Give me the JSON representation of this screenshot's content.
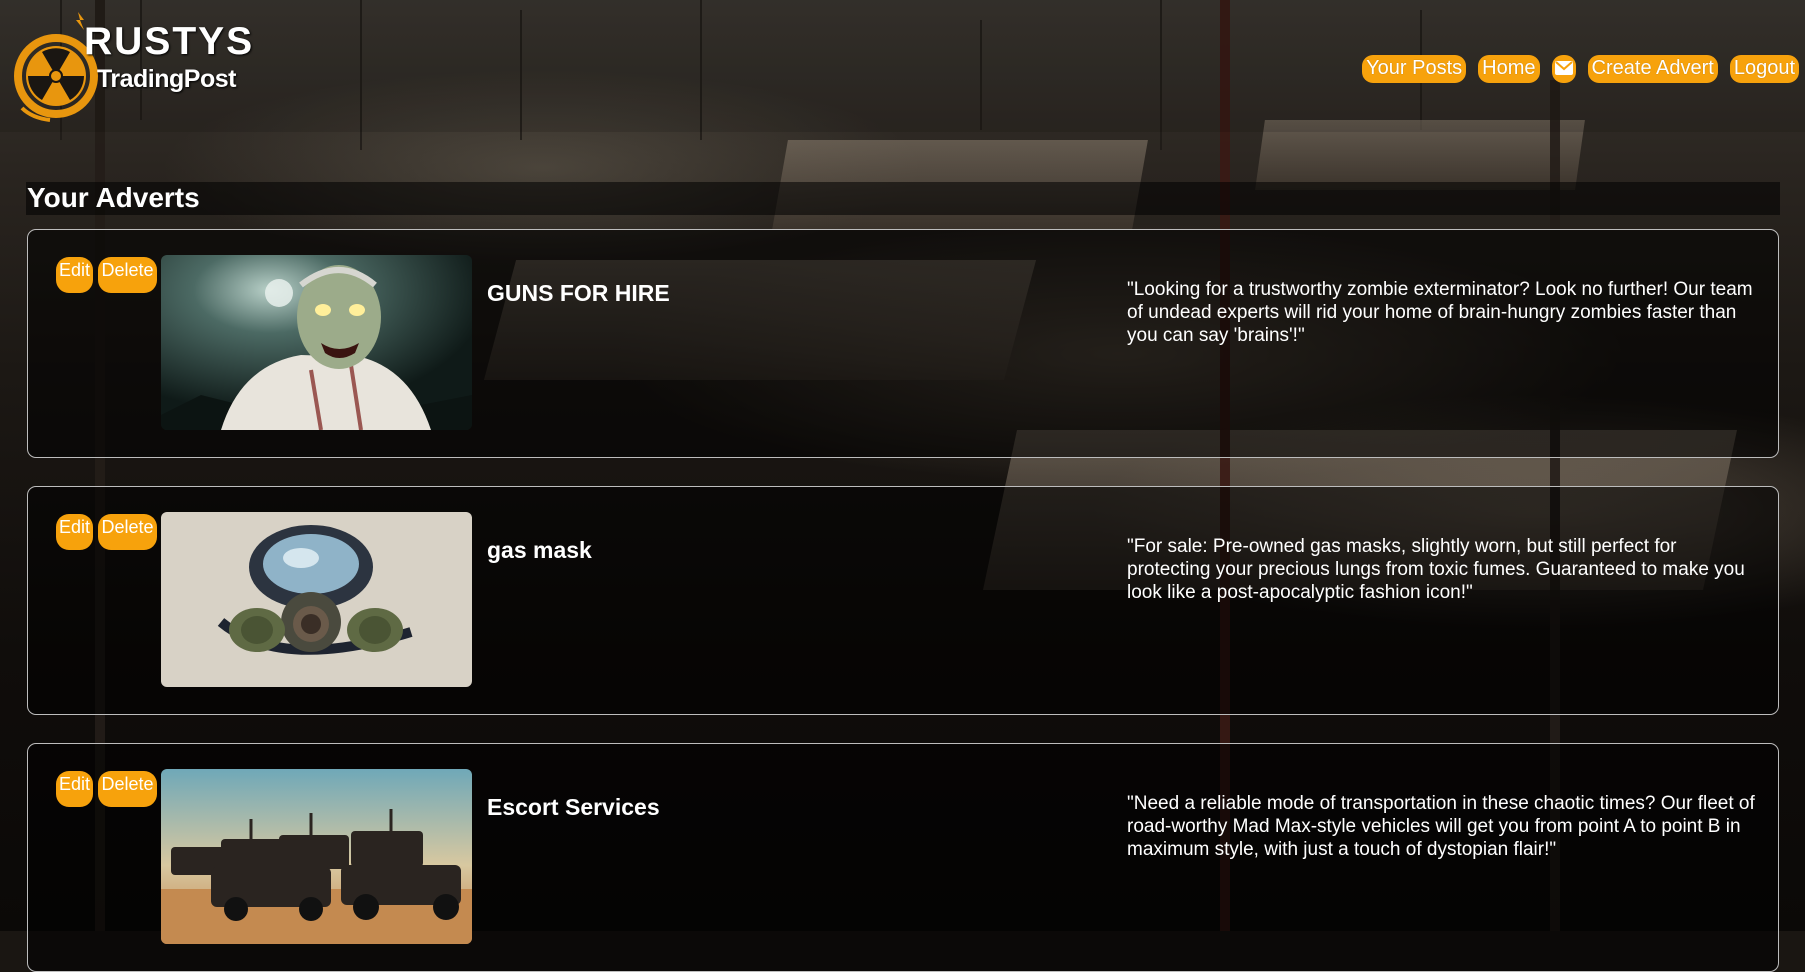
{
  "brand": {
    "name_top": "RUSTYS",
    "name_bottom": "TradingPost",
    "accent_color": "#f7a20c"
  },
  "nav": {
    "your_posts": "Your Posts",
    "home": "Home",
    "messages_icon": "envelope-icon",
    "create_advert": "Create Advert",
    "logout": "Logout"
  },
  "section": {
    "title": "Your Adverts"
  },
  "adverts": [
    {
      "edit_label": "Edit",
      "delete_label": "Delete",
      "image": "zombie-image",
      "title": "GUNS FOR HIRE",
      "description": "\"Looking for a trustworthy zombie exterminator? Look no further! Our team of undead experts will rid your home of brain-hungry zombies faster than you can say 'brains'!\""
    },
    {
      "edit_label": "Edit",
      "delete_label": "Delete",
      "image": "gas-mask-image",
      "title": "gas mask",
      "description": "\"For sale: Pre-owned gas masks, slightly worn, but still perfect for protecting your precious lungs from toxic fumes. Guaranteed to make you look like a post-apocalyptic fashion icon!\""
    },
    {
      "edit_label": "Edit",
      "delete_label": "Delete",
      "image": "vehicles-image",
      "title": "Escort Services",
      "description": "\"Need a reliable mode of transportation in these chaotic times? Our fleet of road-worthy Mad Max-style vehicles will get you from point A to point B in maximum style, with just a touch of dystopian flair!\""
    }
  ]
}
